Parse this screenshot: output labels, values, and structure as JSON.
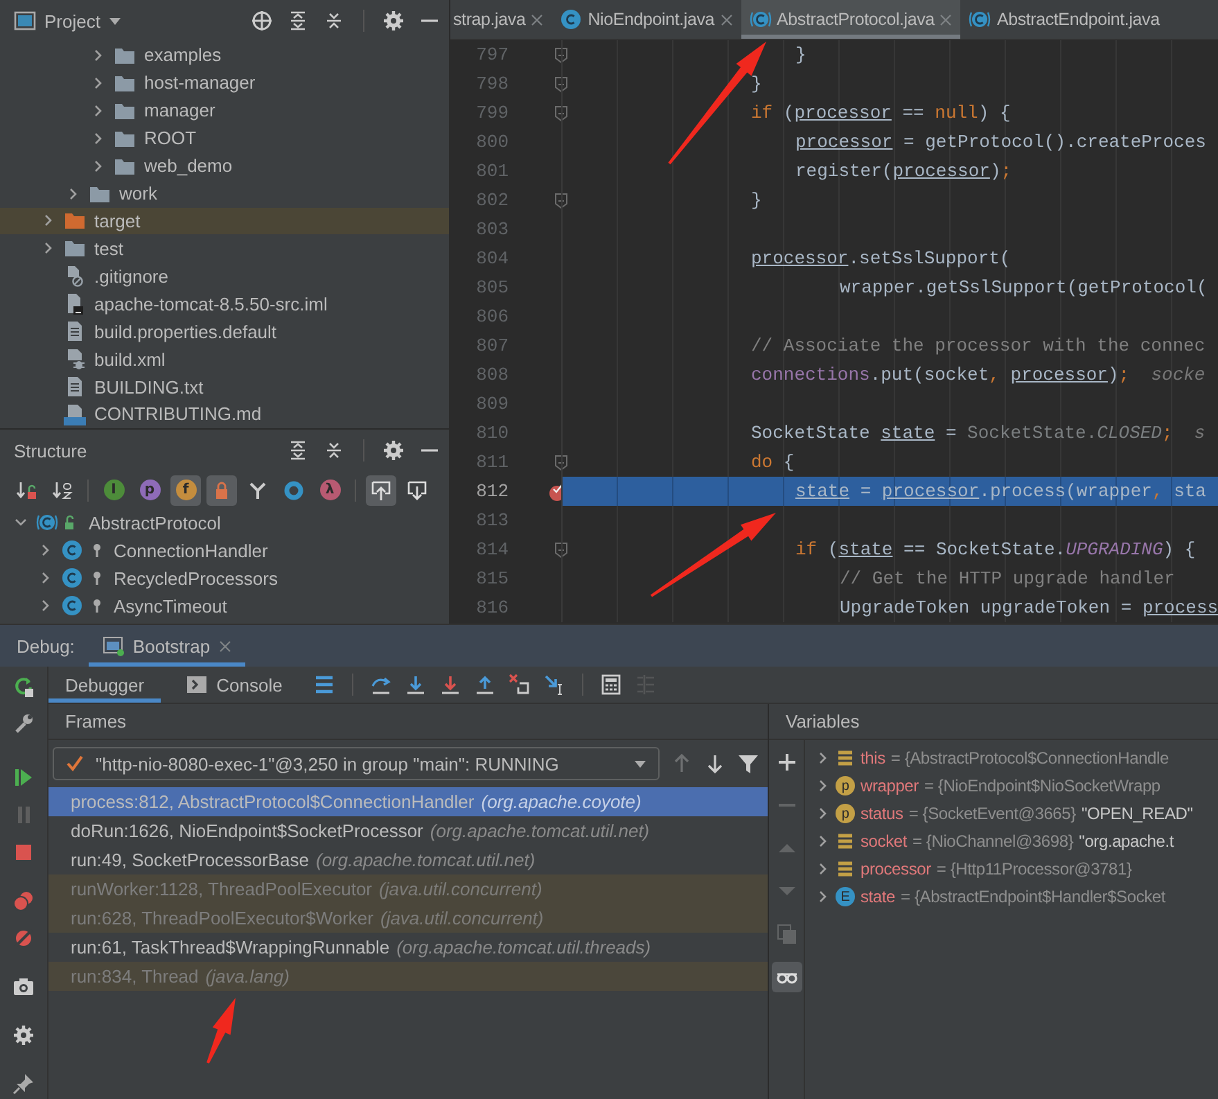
{
  "project": {
    "title": "Project",
    "tree": [
      {
        "children": [
          {
            "children": [
              {
                "label": "examples",
                "kind": "folder",
                "expanded": false,
                "selected": false
              },
              {
                "label": "host-manager",
                "kind": "folder",
                "expanded": false,
                "selected": false
              },
              {
                "label": "manager",
                "kind": "folder",
                "expanded": false,
                "selected": false
              },
              {
                "label": "ROOT",
                "kind": "folder",
                "expanded": false,
                "selected": false
              },
              {
                "label": "web_demo",
                "kind": "folder",
                "expanded": false,
                "selected": false
              }
            ]
          },
          {
            "label": "work",
            "kind": "folder",
            "expanded": false,
            "selected": false
          }
        ]
      },
      {
        "label": "target",
        "kind": "excluded-folder",
        "expanded": false,
        "selected": true
      },
      {
        "label": "test",
        "kind": "folder",
        "expanded": false,
        "selected": false
      },
      {
        "label": ".gitignore",
        "kind": "ignore-file",
        "selected": false
      },
      {
        "label": "apache-tomcat-8.5.50-src.iml",
        "kind": "module-file",
        "selected": false
      },
      {
        "label": "build.properties.default",
        "kind": "text-file",
        "selected": false
      },
      {
        "label": "build.xml",
        "kind": "ant-file",
        "selected": false
      },
      {
        "label": "BUILDING.txt",
        "kind": "text-file",
        "selected": false
      },
      {
        "label": "CONTRIBUTING.md",
        "kind": "markdown-file",
        "selected": false
      }
    ]
  },
  "structure": {
    "title": "Structure",
    "toolbar": [
      {
        "kind": "sort-visibility",
        "on": false
      },
      {
        "kind": "sort-alpha",
        "on": false
      },
      {
        "kind": "separator"
      },
      {
        "kind": "badge",
        "glyph": "I",
        "color": "#4d8c3a",
        "on": false
      },
      {
        "kind": "badge",
        "glyph": "p",
        "color": "#8e6bb8",
        "on": false
      },
      {
        "kind": "badge",
        "glyph": "f",
        "color": "#c48d3e",
        "on": true
      },
      {
        "kind": "lock",
        "on": true
      },
      {
        "kind": "fork",
        "on": false
      },
      {
        "kind": "ring",
        "on": false
      },
      {
        "kind": "badge",
        "glyph": "λ",
        "color": "#b85a72",
        "on": false
      },
      {
        "kind": "separator"
      },
      {
        "kind": "scroll-to",
        "on": true
      },
      {
        "kind": "scroll-from",
        "on": false
      }
    ],
    "tree": [
      {
        "label": "AbstractProtocol",
        "kind": "public",
        "expanded": true,
        "children": [
          {
            "label": "ConnectionHandler",
            "kind": "private",
            "expanded": false
          },
          {
            "label": "RecycledProcessors",
            "kind": "private",
            "expanded": false
          },
          {
            "label": "AsyncTimeout",
            "kind": "private",
            "expanded": false
          }
        ]
      }
    ]
  },
  "editor": {
    "tabs": [
      {
        "label": "strap.java",
        "selected": false,
        "icon": false,
        "close": true
      },
      {
        "label": "NioEndpoint.java",
        "selected": false,
        "icon": true,
        "close": true
      },
      {
        "label": "AbstractProtocol.java",
        "selected": true,
        "icon": true,
        "close": true
      },
      {
        "label": "AbstractEndpoint.java",
        "selected": false,
        "icon": true,
        "close": false
      }
    ],
    "lines": [
      {
        "number": "797",
        "kind": "inner",
        "fold": true,
        "breakpoint": false,
        "current": false,
        "tokens": [
          {
            "kind": "plain",
            "text": "}"
          }
        ]
      },
      {
        "number": "798",
        "kind": "base",
        "fold": true,
        "breakpoint": false,
        "current": false,
        "tokens": [
          {
            "kind": "plain",
            "text": "}"
          }
        ]
      },
      {
        "number": "799",
        "kind": "base",
        "fold": true,
        "breakpoint": false,
        "current": false,
        "tokens": [
          {
            "kind": "keyword",
            "text": "if"
          },
          {
            "kind": "plain",
            "text": " ("
          },
          {
            "kind": "var",
            "text": "processor"
          },
          {
            "kind": "plain",
            "text": " == "
          },
          {
            "kind": "keyword",
            "text": "null"
          },
          {
            "kind": "plain",
            "text": ") {"
          }
        ]
      },
      {
        "number": "800",
        "kind": "inner",
        "fold": false,
        "breakpoint": false,
        "current": false,
        "tokens": [
          {
            "kind": "var",
            "text": "processor"
          },
          {
            "kind": "plain",
            "text": " = getProtocol().createProces"
          }
        ]
      },
      {
        "number": "801",
        "kind": "inner",
        "fold": false,
        "breakpoint": false,
        "current": false,
        "tokens": [
          {
            "kind": "plain",
            "text": "register("
          },
          {
            "kind": "var",
            "text": "processor"
          },
          {
            "kind": "plain",
            "text": ")"
          },
          {
            "kind": "punct",
            "text": ";"
          }
        ]
      },
      {
        "number": "802",
        "kind": "base",
        "fold": true,
        "breakpoint": false,
        "current": false,
        "tokens": [
          {
            "kind": "plain",
            "text": "}"
          }
        ]
      },
      {
        "number": "803",
        "kind": "base",
        "fold": false,
        "breakpoint": false,
        "current": false
      },
      {
        "number": "804",
        "kind": "base",
        "fold": false,
        "breakpoint": false,
        "current": false,
        "tokens": [
          {
            "kind": "var",
            "text": "processor"
          },
          {
            "kind": "plain",
            "text": ".setSslSupport("
          }
        ]
      },
      {
        "number": "805",
        "kind": "inner2",
        "fold": false,
        "breakpoint": false,
        "current": false,
        "tokens": [
          {
            "kind": "plain",
            "text": "wrapper.getSslSupport(getProtocol("
          }
        ]
      },
      {
        "number": "806",
        "kind": "base",
        "fold": false,
        "breakpoint": false,
        "current": false
      },
      {
        "number": "807",
        "kind": "base",
        "fold": false,
        "breakpoint": false,
        "current": false,
        "tokens": [
          {
            "kind": "comment",
            "text": "// Associate the processor with the connec"
          }
        ]
      },
      {
        "number": "808",
        "kind": "base",
        "fold": false,
        "breakpoint": false,
        "current": false,
        "tokens": [
          {
            "kind": "field",
            "text": "connections"
          },
          {
            "kind": "plain",
            "text": ".put(socket"
          },
          {
            "kind": "punct",
            "text": ", "
          },
          {
            "kind": "var",
            "text": "processor"
          },
          {
            "kind": "plain",
            "text": ")"
          },
          {
            "kind": "punct",
            "text": ";"
          },
          {
            "kind": "hint",
            "text": "  socke"
          }
        ]
      },
      {
        "number": "809",
        "kind": "base",
        "fold": false,
        "breakpoint": false,
        "current": false
      },
      {
        "number": "810",
        "kind": "base",
        "fold": false,
        "breakpoint": false,
        "current": false,
        "tokens": [
          {
            "kind": "plain",
            "text": "SocketState "
          },
          {
            "kind": "var",
            "text": "state"
          },
          {
            "kind": "plain",
            "text": " = "
          },
          {
            "kind": "dim",
            "text": "SocketState."
          },
          {
            "kind": "dimconst",
            "text": "CLOSED"
          },
          {
            "kind": "punct",
            "text": ";"
          },
          {
            "kind": "hint",
            "text": "  s"
          }
        ]
      },
      {
        "number": "811",
        "kind": "base",
        "fold": true,
        "breakpoint": false,
        "current": false,
        "tokens": [
          {
            "kind": "keyword",
            "text": "do"
          },
          {
            "kind": "plain",
            "text": " {"
          }
        ]
      },
      {
        "number": "812",
        "kind": "inner",
        "fold": false,
        "breakpoint": true,
        "current": true,
        "tokens": [
          {
            "kind": "var",
            "text": "state"
          },
          {
            "kind": "plain",
            "text": " = "
          },
          {
            "kind": "var",
            "text": "processor"
          },
          {
            "kind": "plain",
            "text": ".process(wrapper"
          },
          {
            "kind": "punct",
            "text": ", "
          },
          {
            "kind": "plain",
            "text": "sta"
          }
        ]
      },
      {
        "number": "813",
        "kind": "base",
        "fold": false,
        "breakpoint": false,
        "current": false
      },
      {
        "number": "814",
        "kind": "inner",
        "fold": true,
        "breakpoint": false,
        "current": false,
        "tokens": [
          {
            "kind": "keyword",
            "text": "if"
          },
          {
            "kind": "plain",
            "text": " ("
          },
          {
            "kind": "var",
            "text": "state"
          },
          {
            "kind": "plain",
            "text": " == SocketState."
          },
          {
            "kind": "const",
            "text": "UPGRADING"
          },
          {
            "kind": "plain",
            "text": ") {"
          }
        ]
      },
      {
        "number": "815",
        "kind": "inner2",
        "fold": false,
        "breakpoint": false,
        "current": false,
        "tokens": [
          {
            "kind": "comment",
            "text": "// Get the HTTP upgrade handler"
          }
        ]
      },
      {
        "number": "816",
        "kind": "inner2",
        "fold": false,
        "breakpoint": false,
        "current": false,
        "tokens": [
          {
            "kind": "plain",
            "text": "UpgradeToken upgradeToken = "
          },
          {
            "kind": "var",
            "text": "process"
          }
        ]
      }
    ]
  },
  "debug": {
    "label": "Debug:",
    "tabs": [
      {
        "label": "Bootstrap",
        "selected": true
      }
    ],
    "views": [
      {
        "label": "Debugger",
        "kind": "debugger",
        "selected": true
      },
      {
        "label": "Console",
        "kind": "console",
        "selected": false
      }
    ],
    "actions": [
      {
        "kind": "layout",
        "disabled": false
      },
      {
        "kind": "separator"
      },
      {
        "kind": "step-over",
        "disabled": false
      },
      {
        "kind": "step-into",
        "disabled": false
      },
      {
        "kind": "force-step-into",
        "disabled": false
      },
      {
        "kind": "step-out",
        "disabled": false
      },
      {
        "kind": "drop-frame",
        "disabled": false
      },
      {
        "kind": "run-to-cursor",
        "disabled": false
      },
      {
        "kind": "separator"
      },
      {
        "kind": "evaluate",
        "disabled": false
      },
      {
        "kind": "trace",
        "disabled": true
      }
    ],
    "frames": {
      "title": "Frames",
      "thread": "\"http-nio-8080-exec-1\"@3,250 in group \"main\": RUNNING",
      "nav": [
        {
          "kind": "up",
          "disabled": true
        },
        {
          "kind": "down",
          "disabled": false
        },
        {
          "kind": "filter",
          "disabled": false
        }
      ],
      "rows": [
        {
          "method": "process:812, AbstractProtocol$ConnectionHandler",
          "package": "(org.apache.coyote)",
          "kind": "app",
          "selected": true
        },
        {
          "method": "doRun:1626, NioEndpoint$SocketProcessor",
          "package": "(org.apache.tomcat.util.net)",
          "kind": "app",
          "selected": false
        },
        {
          "method": "run:49, SocketProcessorBase",
          "package": "(org.apache.tomcat.util.net)",
          "kind": "app",
          "selected": false
        },
        {
          "method": "runWorker:1128, ThreadPoolExecutor",
          "package": "(java.util.concurrent)",
          "kind": "library",
          "selected": false
        },
        {
          "method": "run:628, ThreadPoolExecutor$Worker",
          "package": "(java.util.concurrent)",
          "kind": "library",
          "selected": false
        },
        {
          "method": "run:61, TaskThread$WrappingRunnable",
          "package": "(org.apache.tomcat.util.threads)",
          "kind": "app",
          "selected": false
        },
        {
          "method": "run:834, Thread",
          "package": "(java.lang)",
          "kind": "library",
          "selected": false
        }
      ]
    },
    "variables": {
      "title": "Variables",
      "tools": [
        {
          "kind": "add",
          "disabled": false,
          "on": false
        },
        {
          "kind": "remove",
          "disabled": true,
          "on": false
        },
        {
          "kind": "up",
          "disabled": true,
          "on": false
        },
        {
          "kind": "down",
          "disabled": true,
          "on": false
        },
        {
          "kind": "copy",
          "disabled": true,
          "on": false
        },
        {
          "kind": "watches",
          "disabled": false,
          "on": true
        }
      ],
      "rows": [
        {
          "name": "this",
          "kind": "field",
          "value": "= {AbstractProtocol$ConnectionHandle"
        },
        {
          "name": "wrapper",
          "kind": "param",
          "badge": "p",
          "value": "= {NioEndpoint$NioSocketWrapp"
        },
        {
          "name": "status",
          "kind": "param",
          "badge": "p",
          "value": "= {SocketEvent@3665}",
          "string": "\"OPEN_READ\""
        },
        {
          "name": "socket",
          "kind": "field",
          "value": "= {NioChannel@3698}",
          "string": "\"org.apache.t"
        },
        {
          "name": "processor",
          "kind": "field",
          "value": "= {Http11Processor@3781}"
        },
        {
          "name": "state",
          "kind": "enum",
          "badge": "E",
          "value": "= {AbstractEndpoint$Handler$Socket"
        }
      ]
    }
  }
}
